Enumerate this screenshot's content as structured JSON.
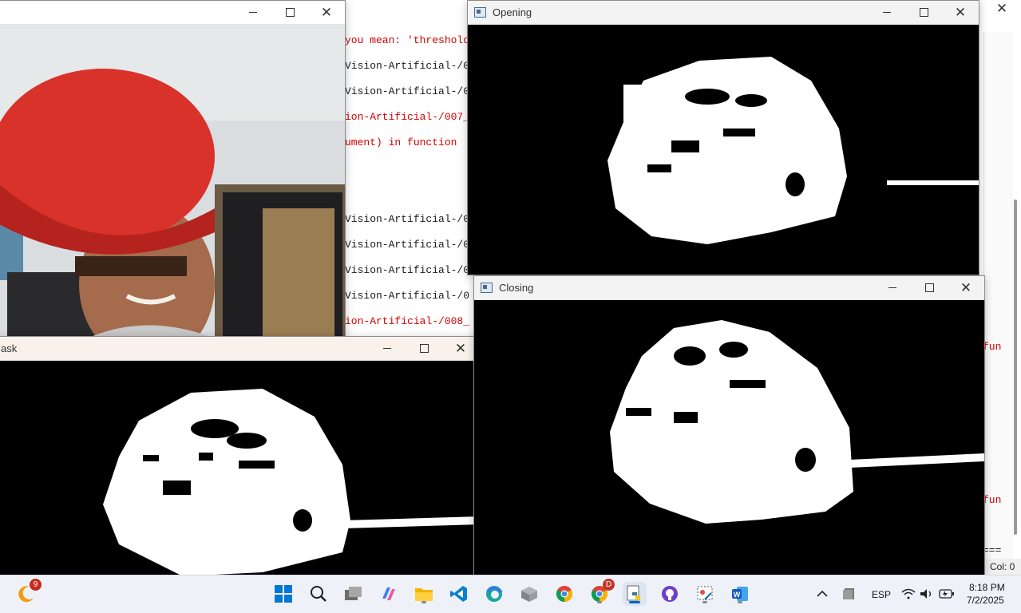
{
  "ide": {
    "lines": [
      {
        "text": "you mean: 'threshold",
        "color": "#d40000"
      },
      {
        "text": "Vision-Artificial-/0",
        "color": "#1a1a1a"
      },
      {
        "text": "Vision-Artificial-/0",
        "color": "#1a1a1a"
      },
      {
        "text": "ion-Artificial-/007_",
        "color": "#d40000"
      },
      {
        "text": "ument) in function ",
        "color": "#d40000"
      },
      {
        "text": "Vision-Artificial-/0",
        "color": "#1a1a1a"
      },
      {
        "text": "Vision-Artificial-/0",
        "color": "#1a1a1a"
      },
      {
        "text": "Vision-Artificial-/0",
        "color": "#1a1a1a"
      },
      {
        "text": "Vision-Artificial-/0",
        "color": "#1a1a1a"
      },
      {
        "text": "ion-Artificial-/008_",
        "color": "#d40000"
      }
    ],
    "right_fragments": [
      "fun",
      "fun",
      "==="
    ],
    "status_col": "Col: 0"
  },
  "windows": {
    "camera": {
      "title": ""
    },
    "mask": {
      "title": "ask"
    },
    "opening": {
      "title": "Opening"
    },
    "closing": {
      "title": "Closing"
    }
  },
  "taskbar": {
    "notification_badge": "9",
    "chrome_badge": "D",
    "apps": [
      "widgets-icon",
      "start-icon",
      "search-icon",
      "task-view-icon",
      "copilot-icon",
      "file-explorer-icon",
      "vscode-icon",
      "edge-icon",
      "box-icon",
      "chrome-icon",
      "chrome-profile-icon",
      "python-icon",
      "github-icon",
      "snipping-icon",
      "word-icon"
    ],
    "language": "ESP",
    "time": "8:18 PM",
    "date": "7/2/2025"
  },
  "colors": {
    "error_text": "#d40000",
    "taskbar_bg": "#eef2f8",
    "accent": "#0067c0"
  }
}
